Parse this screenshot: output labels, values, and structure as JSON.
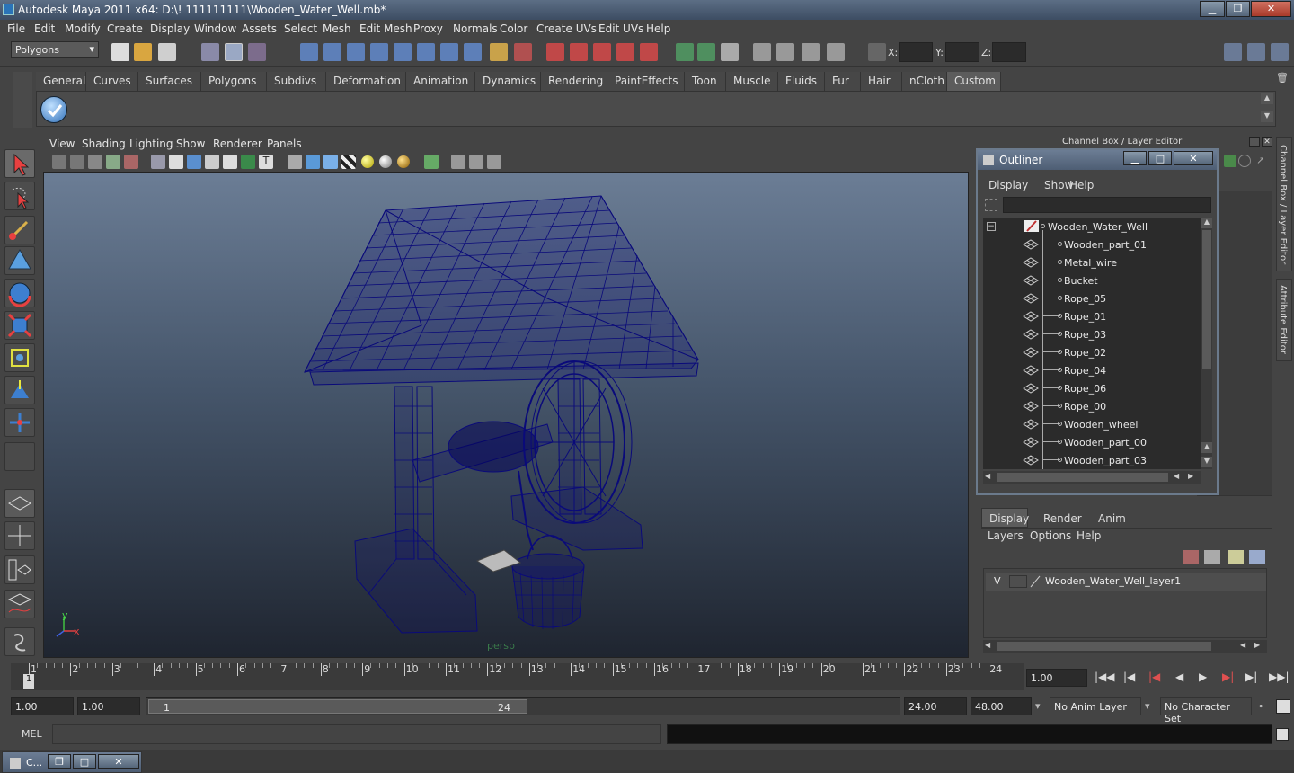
{
  "window": {
    "title": "Autodesk Maya 2011 x64: D:\\! 111111111\\Wooden_Water_Well.mb*"
  },
  "menubar": [
    "File",
    "Edit",
    "Modify",
    "Create",
    "Display",
    "Window",
    "Assets",
    "Select",
    "Mesh",
    "Edit Mesh",
    "Proxy",
    "Normals",
    "Color",
    "Create UVs",
    "Edit UVs",
    "Help"
  ],
  "statusline": {
    "mode": "Polygons",
    "x_label": "X:",
    "y_label": "Y:",
    "z_label": "Z:"
  },
  "shelf_tabs": [
    "General",
    "Curves",
    "Surfaces",
    "Polygons",
    "Subdivs",
    "Deformation",
    "Animation",
    "Dynamics",
    "Rendering",
    "PaintEffects",
    "Toon",
    "Muscle",
    "Fluids",
    "Fur",
    "Hair",
    "nCloth",
    "Custom"
  ],
  "shelf_active": "Custom",
  "viewport": {
    "menu": [
      "View",
      "Shading",
      "Lighting",
      "Show",
      "Renderer",
      "Panels"
    ],
    "camera_label": "persp",
    "axis_y": "y",
    "axis_x": "x"
  },
  "right_panel": {
    "title": "Channel Box / Layer Editor",
    "side_tab_1": "Channel Box / Layer Editor",
    "side_tab_2": "Attribute Editor"
  },
  "outliner": {
    "title": "Outliner",
    "menu": [
      "Display",
      "Show",
      "Help"
    ],
    "root": "Wooden_Water_Well",
    "items": [
      "Wooden_part_01",
      "Metal_wire",
      "Bucket",
      "Rope_05",
      "Rope_01",
      "Rope_03",
      "Rope_02",
      "Rope_04",
      "Rope_06",
      "Rope_00",
      "Wooden_wheel",
      "Wooden_part_00",
      "Wooden_part_03"
    ]
  },
  "layer_editor": {
    "tabs": [
      "Display",
      "Render",
      "Anim"
    ],
    "menu": [
      "Layers",
      "Options",
      "Help"
    ],
    "layer_visibility": "V",
    "layer_name": "Wooden_Water_Well_layer1"
  },
  "timeline": {
    "frames": [
      "1",
      "2",
      "3",
      "4",
      "5",
      "6",
      "7",
      "8",
      "9",
      "10",
      "11",
      "12",
      "13",
      "14",
      "15",
      "16",
      "17",
      "18",
      "19",
      "20",
      "21",
      "22",
      "23",
      "24"
    ],
    "current_frame_marker": "1",
    "current_time": "1.00"
  },
  "range": {
    "start": "1.00",
    "playback_start": "1.00",
    "slider_start": "1",
    "slider_end": "24",
    "playback_end": "24.00",
    "end": "48.00",
    "anim_layer": "No Anim Layer",
    "character_set": "No Character Set"
  },
  "command_line": {
    "label": "MEL"
  },
  "taskbar": {
    "item": "C..."
  }
}
